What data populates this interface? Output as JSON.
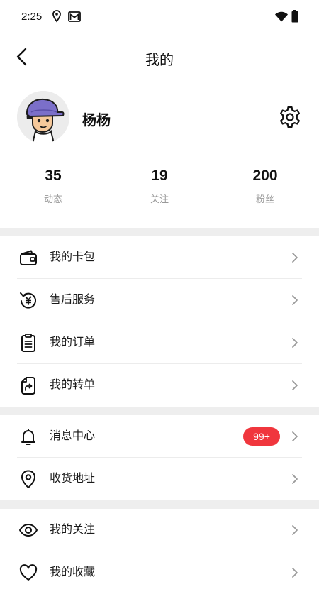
{
  "status_bar": {
    "time": "2:25",
    "icons": [
      "location-icon",
      "gmail-icon",
      "wifi-icon",
      "battery-icon"
    ]
  },
  "nav": {
    "title": "我的",
    "back_icon": "back-arrow-icon"
  },
  "profile": {
    "username": "杨杨",
    "avatar": "cartoon-avatar-purple-cap",
    "settings_icon": "gear-icon"
  },
  "stats": [
    {
      "value": "35",
      "label": "动态"
    },
    {
      "value": "19",
      "label": "关注"
    },
    {
      "value": "200",
      "label": "粉丝"
    }
  ],
  "menu": {
    "group1": [
      {
        "label": "我的卡包",
        "icon": "wallet-icon"
      },
      {
        "label": "售后服务",
        "icon": "refund-yen-icon"
      },
      {
        "label": "我的订单",
        "icon": "clipboard-list-icon"
      },
      {
        "label": "我的转单",
        "icon": "transfer-document-icon"
      }
    ],
    "group2": [
      {
        "label": "消息中心",
        "icon": "bell-icon",
        "badge": "99+"
      },
      {
        "label": "收货地址",
        "icon": "location-pin-icon"
      }
    ],
    "group3": [
      {
        "label": "我的关注",
        "icon": "eye-icon"
      },
      {
        "label": "我的收藏",
        "icon": "heart-icon"
      }
    ]
  },
  "colors": {
    "badge": "#f0363d",
    "section_gap": "#eeeeee",
    "muted_text": "#999999",
    "chevron": "#9a9a9a"
  }
}
